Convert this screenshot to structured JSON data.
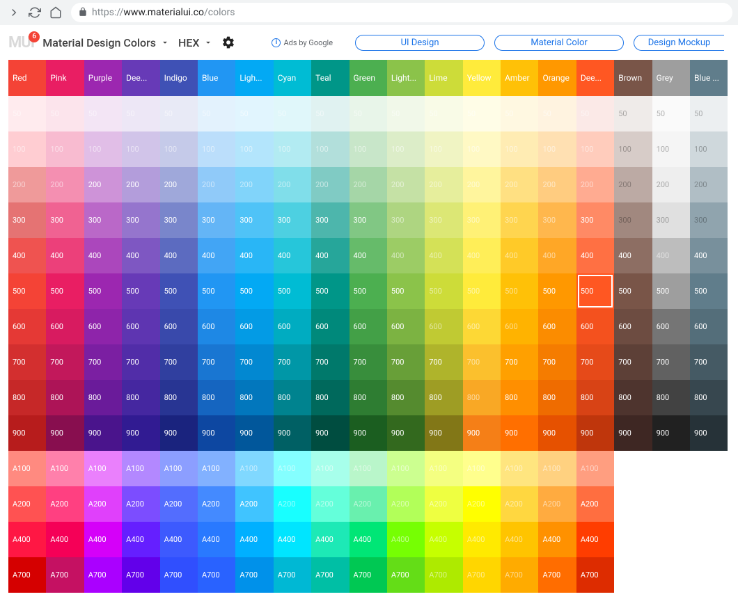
{
  "browser": {
    "url_prefix": "https://",
    "url_host": "www.materialui.co",
    "url_path": "/colors"
  },
  "header": {
    "badge": "6",
    "title": "Material Design Colors",
    "format": "HEX",
    "ads_label": "Ads by Google",
    "pills": [
      "UI Design",
      "Material Color",
      "Design Mockup"
    ]
  },
  "shades": [
    "50",
    "100",
    "200",
    "300",
    "400",
    "500",
    "600",
    "700",
    "800",
    "900",
    "A100",
    "A200",
    "A400",
    "A700"
  ],
  "selected": {
    "colorIndex": 15,
    "shadeIndex": 5
  },
  "colors": [
    {
      "name": "Red",
      "swatches": [
        "#f44336",
        "#ffebee",
        "#ffcdd2",
        "#ef9a9a",
        "#e57373",
        "#ef5350",
        "#f44336",
        "#e53935",
        "#d32f2f",
        "#c62828",
        "#b71c1c",
        "#ff8a80",
        "#ff5252",
        "#ff1744",
        "#d50000"
      ]
    },
    {
      "name": "Pink",
      "swatches": [
        "#e91e63",
        "#fce4ec",
        "#f8bbd0",
        "#f48fb1",
        "#f06292",
        "#ec407a",
        "#e91e63",
        "#d81b60",
        "#c2185b",
        "#ad1457",
        "#880e4f",
        "#ff80ab",
        "#ff4081",
        "#f50057",
        "#c51162"
      ]
    },
    {
      "name": "Purple",
      "swatches": [
        "#9c27b0",
        "#f3e5f5",
        "#e1bee7",
        "#ce93d8",
        "#ba68c8",
        "#ab47bc",
        "#9c27b0",
        "#8e24aa",
        "#7b1fa2",
        "#6a1b9a",
        "#4a148c",
        "#ea80fc",
        "#e040fb",
        "#d500f9",
        "#aa00ff"
      ]
    },
    {
      "name": "Deep Purple",
      "swatches": [
        "#673ab7",
        "#ede7f6",
        "#d1c4e9",
        "#b39ddb",
        "#9575cd",
        "#7e57c2",
        "#673ab7",
        "#5e35b1",
        "#512da8",
        "#4527a0",
        "#311b92",
        "#b388ff",
        "#7c4dff",
        "#651fff",
        "#6200ea"
      ]
    },
    {
      "name": "Indigo",
      "swatches": [
        "#3f51b5",
        "#e8eaf6",
        "#c5cae9",
        "#9fa8da",
        "#7986cb",
        "#5c6bc0",
        "#3f51b5",
        "#3949ab",
        "#303f9f",
        "#283593",
        "#1a237e",
        "#8c9eff",
        "#536dfe",
        "#3d5afe",
        "#304ffe"
      ]
    },
    {
      "name": "Blue",
      "swatches": [
        "#2196f3",
        "#e3f2fd",
        "#bbdefb",
        "#90caf9",
        "#64b5f6",
        "#42a5f5",
        "#2196f3",
        "#1e88e5",
        "#1976d2",
        "#1565c0",
        "#0d47a1",
        "#82b1ff",
        "#448aff",
        "#2979ff",
        "#2962ff"
      ]
    },
    {
      "name": "Light Blue",
      "swatches": [
        "#03a9f4",
        "#e1f5fe",
        "#b3e5fc",
        "#81d4fa",
        "#4fc3f7",
        "#29b6f6",
        "#03a9f4",
        "#039be5",
        "#0288d1",
        "#0277bd",
        "#01579b",
        "#80d8ff",
        "#40c4ff",
        "#00b0ff",
        "#0091ea"
      ]
    },
    {
      "name": "Cyan",
      "swatches": [
        "#00bcd4",
        "#e0f7fa",
        "#b2ebf2",
        "#80deea",
        "#4dd0e1",
        "#26c6da",
        "#00bcd4",
        "#00acc1",
        "#0097a7",
        "#00838f",
        "#006064",
        "#84ffff",
        "#18ffff",
        "#00e5ff",
        "#00b8d4"
      ]
    },
    {
      "name": "Teal",
      "swatches": [
        "#009688",
        "#e0f2f1",
        "#b2dfdb",
        "#80cbc4",
        "#4db6ac",
        "#26a69a",
        "#009688",
        "#00897b",
        "#00796b",
        "#00695c",
        "#004d40",
        "#a7ffeb",
        "#64ffda",
        "#1de9b6",
        "#00bfa5"
      ]
    },
    {
      "name": "Green",
      "swatches": [
        "#4caf50",
        "#e8f5e9",
        "#c8e6c9",
        "#a5d6a7",
        "#81c784",
        "#66bb6a",
        "#4caf50",
        "#43a047",
        "#388e3c",
        "#2e7d32",
        "#1b5e20",
        "#b9f6ca",
        "#69f0ae",
        "#00e676",
        "#00c853"
      ]
    },
    {
      "name": "Light Green",
      "swatches": [
        "#8bc34a",
        "#f1f8e9",
        "#dcedc8",
        "#c5e1a5",
        "#aed581",
        "#9ccc65",
        "#8bc34a",
        "#7cb342",
        "#689f38",
        "#558b2f",
        "#33691e",
        "#ccff90",
        "#b2ff59",
        "#76ff03",
        "#64dd17"
      ]
    },
    {
      "name": "Lime",
      "swatches": [
        "#cddc39",
        "#f9fbe7",
        "#f0f4c3",
        "#e6ee9c",
        "#dce775",
        "#d4e157",
        "#cddc39",
        "#c0ca33",
        "#afb42b",
        "#9e9d24",
        "#827717",
        "#f4ff81",
        "#eeff41",
        "#c6ff00",
        "#aeea00"
      ]
    },
    {
      "name": "Yellow",
      "swatches": [
        "#ffeb3b",
        "#fffde7",
        "#fff9c4",
        "#fff59d",
        "#fff176",
        "#ffee58",
        "#ffeb3b",
        "#fdd835",
        "#fbc02d",
        "#f9a825",
        "#f57f17",
        "#ffff8d",
        "#ffff00",
        "#ffea00",
        "#ffd600"
      ]
    },
    {
      "name": "Amber",
      "swatches": [
        "#ffc107",
        "#fff8e1",
        "#ffecb3",
        "#ffe082",
        "#ffd54f",
        "#ffca28",
        "#ffc107",
        "#ffb300",
        "#ffa000",
        "#ff8f00",
        "#ff6f00",
        "#ffe57f",
        "#ffd740",
        "#ffc400",
        "#ffab00"
      ]
    },
    {
      "name": "Orange",
      "swatches": [
        "#ff9800",
        "#fff3e0",
        "#ffe0b2",
        "#ffcc80",
        "#ffb74d",
        "#ffa726",
        "#ff9800",
        "#fb8c00",
        "#f57c00",
        "#ef6c00",
        "#e65100",
        "#ffd180",
        "#ffab40",
        "#ff9100",
        "#ff6d00"
      ]
    },
    {
      "name": "Deep Orange",
      "swatches": [
        "#ff5722",
        "#fbe9e7",
        "#ffccbc",
        "#ffab91",
        "#ff8a65",
        "#ff7043",
        "#ff5722",
        "#f4511e",
        "#e64a19",
        "#d84315",
        "#bf360c",
        "#ff9e80",
        "#ff6e40",
        "#ff3d00",
        "#dd2c00"
      ]
    },
    {
      "name": "Brown",
      "swatches": [
        "#795548",
        "#efebe9",
        "#d7ccc8",
        "#bcaaa4",
        "#a1887f",
        "#8d6e63",
        "#795548",
        "#6d4c41",
        "#5d4037",
        "#4e342e",
        "#3e2723"
      ]
    },
    {
      "name": "Grey",
      "swatches": [
        "#9e9e9e",
        "#fafafa",
        "#f5f5f5",
        "#eeeeee",
        "#e0e0e0",
        "#bdbdbd",
        "#9e9e9e",
        "#757575",
        "#616161",
        "#424242",
        "#212121"
      ]
    },
    {
      "name": "Blue Grey",
      "swatches": [
        "#607d8b",
        "#eceff1",
        "#cfd8dc",
        "#b0bec5",
        "#90a4ae",
        "#78909c",
        "#607d8b",
        "#546e7a",
        "#455a64",
        "#37474f",
        "#263238"
      ]
    }
  ]
}
